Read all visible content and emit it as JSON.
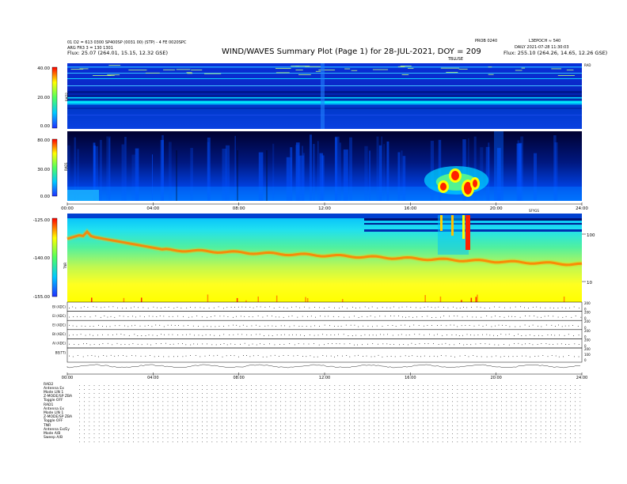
{
  "header": {
    "left_line1": "01 D2 = 613 0300 SP400SP (0031 00) (STP) - 4 FE 0020SPC",
    "left_line2": "ARG FR3 3 = 130 1301",
    "left_line3": "Flux:   25.07 (264.01, 15.15, 12.32 GSE)",
    "title": "WIND/WAVES Summary Plot (Page 1) for 28-JUL-2021, DOY = 209",
    "right_code_a": "PROB 0240",
    "right_code_b": "L3EPOCH ≈ 540",
    "right_line2": "DAILY  2021-07-28 11:30:03",
    "right_line3": "Flux:   255.10 (264.26, 14.65, 12.26 GSE)",
    "right_tag": "TBLUSE"
  },
  "panels": {
    "rad2": {
      "label": "RAD2",
      "ticks": [
        "40.00",
        "20.00",
        "0.00"
      ],
      "right_tag": "RAD"
    },
    "rad1": {
      "label": "RAD1",
      "ticks": [
        "80.00",
        "30.00",
        "0.00"
      ]
    },
    "tnr": {
      "label": "TNR",
      "ticks": [
        "-125.00",
        "-140.00",
        "-155.00"
      ],
      "right_ticks": [
        "100",
        "10"
      ],
      "right_tag": "SFYGS"
    },
    "time_ticks_mid": [
      "00:00",
      "04:00",
      "08:00",
      "12:00",
      "16:00",
      "20:00",
      "24:00"
    ],
    "line_panels": [
      {
        "label": "BI (ADC)",
        "right": [
          "200",
          "0"
        ]
      },
      {
        "label": "EI (ADC)",
        "right": [
          "200",
          "0"
        ]
      },
      {
        "label": "EI (ADC)",
        "right": [
          "200",
          "0"
        ]
      },
      {
        "label": "BI (ADC)",
        "right": [
          "200",
          "0"
        ]
      },
      {
        "label": "AI (ADC)",
        "right": [
          "200",
          "0"
        ]
      },
      {
        "label": "BE(TT)",
        "right": [
          "200",
          "100",
          "0"
        ]
      }
    ],
    "time_ticks_bottom": [
      "00:00",
      "04:00",
      "08:00",
      "12:00",
      "16:00",
      "20:00",
      "24:00"
    ]
  },
  "footer": {
    "rad2": [
      "RAD2",
      "Antenna    Ex",
      "Mode    LIN 1",
      "Z-MODE/SP  ZBA",
      "Toggle    OFF"
    ],
    "rad1": [
      "RAD1",
      "Antenna    Ex",
      "Mode    LIN 1",
      "Z-MODE/SP  ZBA",
      "Toggle    OFF"
    ],
    "tnr": [
      "TNR",
      "Antenna    Ex/Ey",
      "Mode    A/B",
      "Sweep    A/B"
    ]
  },
  "chart_data": {
    "type": "heatmap",
    "title": "WIND/WAVES Summary Plot (Page 1) for 28-JUL-2021, DOY = 209",
    "x": {
      "start": "00:00",
      "end": "24:00",
      "ticks": [
        "00:00",
        "04:00",
        "08:00",
        "12:00",
        "16:00",
        "20:00",
        "24:00"
      ]
    },
    "series": [
      {
        "name": "RAD2",
        "y_ticks": [
          40,
          20,
          0
        ]
      },
      {
        "name": "RAD1",
        "y_ticks": [
          80,
          30,
          0
        ]
      },
      {
        "name": "TNR",
        "y_ticks": [
          -125,
          -140,
          -155
        ]
      }
    ],
    "bursts": [
      {
        "panel": "RAD1",
        "time_hours": [
          17.2,
          19.1
        ]
      },
      {
        "panel": "TNR",
        "time_hours": [
          17.5,
          18.5
        ]
      }
    ],
    "colors": {
      "low": "#000060",
      "mid": "#00a0ff",
      "high": "#ffff00",
      "peak": "#ff0000"
    }
  }
}
